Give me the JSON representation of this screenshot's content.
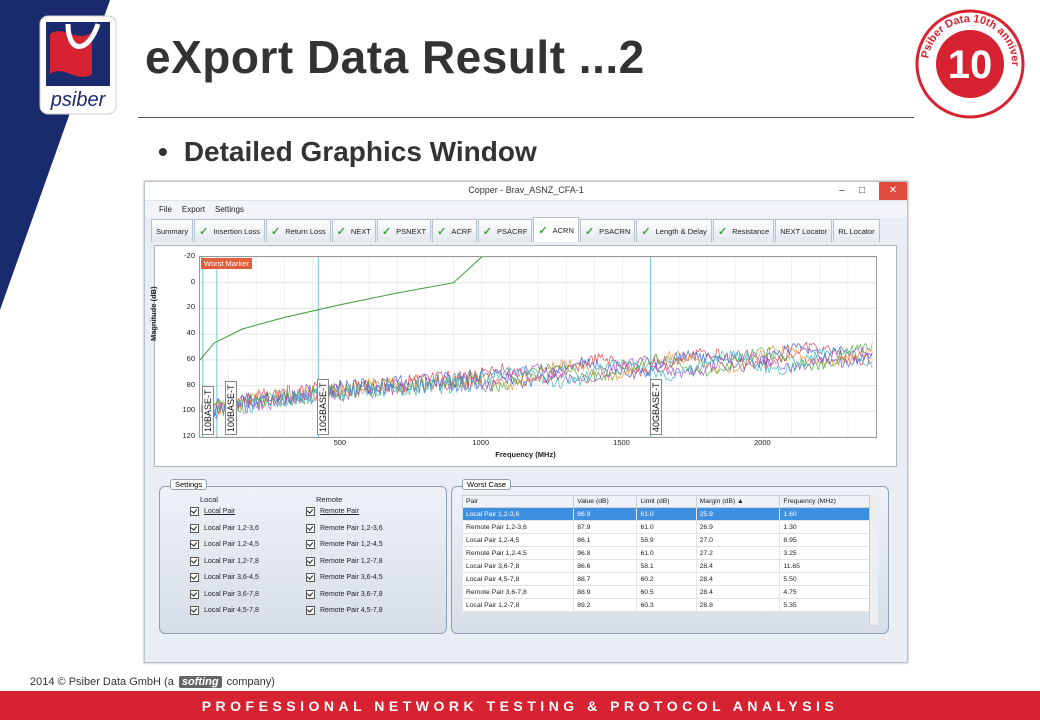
{
  "slide": {
    "title": "eXport Data Result ...2",
    "bullet": "Detailed Graphics Window",
    "logo_text": "psiber",
    "badge_text": "Psiber Data 10th anniversary",
    "badge_number": "10",
    "footer": {
      "copyright_prefix": "2014 © Psiber Data GmbH  (a",
      "company_logo": "softing",
      "copyright_suffix": "company)",
      "tagline": "PROFESSIONAL NETWORK TESTING & PROTOCOL ANALYSIS"
    }
  },
  "window": {
    "title": "Copper - Brav_ASNZ_CFA-1",
    "controls": {
      "minimize": "–",
      "maximize": "□",
      "close": "✕"
    },
    "menu": [
      "File",
      "Export",
      "Settings"
    ],
    "tabs": [
      {
        "label": "Summary",
        "check": false
      },
      {
        "label": "Insertion Loss",
        "check": true
      },
      {
        "label": "Return Loss",
        "check": true
      },
      {
        "label": "NEXT",
        "check": true
      },
      {
        "label": "PSNEXT",
        "check": true
      },
      {
        "label": "ACRF",
        "check": true
      },
      {
        "label": "PSACRF",
        "check": true
      },
      {
        "label": "ACRN",
        "check": true,
        "active": true
      },
      {
        "label": "PSACRN",
        "check": true
      },
      {
        "label": "Length & Delay",
        "check": true
      },
      {
        "label": "Resistance",
        "check": true
      },
      {
        "label": "NEXT Locator",
        "check": false
      },
      {
        "label": "RL Locator",
        "check": false
      }
    ]
  },
  "chart_data": {
    "type": "line",
    "xlabel": "Frequency (MHz)",
    "ylabel": "Magnitude (dB)",
    "xlim": [
      0,
      2400
    ],
    "ylim": [
      -20,
      120
    ],
    "y_inverted": true,
    "x_ticks": [
      500,
      1000,
      1500,
      2000
    ],
    "y_ticks": [
      -20,
      0,
      20,
      40,
      60,
      80,
      100,
      120
    ],
    "grid": true,
    "worst_marker_label": "Worst Marker",
    "markers": [
      {
        "label": "10BASE-T",
        "x": 10
      },
      {
        "label": "100BASE-T",
        "x": 60
      },
      {
        "label": "10GBASE-T",
        "x": 420
      },
      {
        "label": "40GBASE-T",
        "x": 1600
      }
    ],
    "limit_line": {
      "name": "Limit",
      "color": "#3c9a3c",
      "x": [
        0,
        50,
        150,
        300,
        500,
        700,
        900,
        1000
      ],
      "y": [
        60,
        47,
        36,
        27,
        17,
        8,
        0,
        -20
      ]
    },
    "measured_series": [
      {
        "name": "Pair 1,2-3,6",
        "color": "#e0303a"
      },
      {
        "name": "Pair 1,2-4,5",
        "color": "#2b4fd8"
      },
      {
        "name": "Pair 1,2-7,8",
        "color": "#f08a24"
      },
      {
        "name": "Pair 3,6-4,5",
        "color": "#3aa63a"
      },
      {
        "name": "Pair 3,6-7,8",
        "color": "#9b3fc8"
      },
      {
        "name": "Pair 4,5-7,8",
        "color": "#2cb0c0"
      }
    ],
    "measured_envelope": {
      "x": [
        0,
        200,
        400,
        600,
        800,
        1000,
        1200,
        1400,
        1600,
        1800,
        2000,
        2200,
        2400
      ],
      "y": [
        98,
        90,
        84,
        80,
        77,
        73,
        70,
        66,
        63,
        60,
        58,
        56,
        54
      ]
    }
  },
  "settings": {
    "group_label": "Settings",
    "local_head": "Local",
    "remote_head": "Remote",
    "local": [
      "Local Pair",
      "Local Pair 1,2-3,6",
      "Local Pair 1,2-4,5",
      "Local Pair 1,2-7,8",
      "Local Pair 3,6-4,5",
      "Local Pair 3,6-7,8",
      "Local Pair 4,5-7,8"
    ],
    "remote": [
      "Remote Pair",
      "Remote Pair 1,2-3,6",
      "Remote Pair 1,2-4,5",
      "Remote Pair 1,2-7,8",
      "Remote Pair 3,6-4,5",
      "Remote Pair 3,6-7,8",
      "Remote Pair 4,5-7,8"
    ]
  },
  "worst_case": {
    "group_label": "Worst Case",
    "columns": [
      "Pair",
      "Value (dB)",
      "Limit (dB)",
      "Margin (dB)",
      "Frequency (MHz)"
    ],
    "rows": [
      [
        "Local Pair 1,2-3,6",
        "86.9",
        "61.0",
        "25.9",
        "1.60"
      ],
      [
        "Remote Pair 1,2-3,6",
        "87.9",
        "61.0",
        "26.9",
        "1.30"
      ],
      [
        "Local Pair 1,2-4,5",
        "86.1",
        "58.9",
        "27.0",
        "8.95"
      ],
      [
        "Remote Pair 1,2-4,5",
        "96.8",
        "61.0",
        "27.2",
        "3.25"
      ],
      [
        "Local Pair 3,6-7,8",
        "86.6",
        "58.1",
        "28.4",
        "11.65"
      ],
      [
        "Local Pair 4,5-7,8",
        "88.7",
        "60.2",
        "28.4",
        "5.50"
      ],
      [
        "Remote Pair 3,6-7,8",
        "88.9",
        "60.5",
        "28.4",
        "4.75"
      ],
      [
        "Local Pair 1,2-7,8",
        "89.2",
        "60.3",
        "28.8",
        "5.35"
      ]
    ],
    "selected_row": 0
  }
}
